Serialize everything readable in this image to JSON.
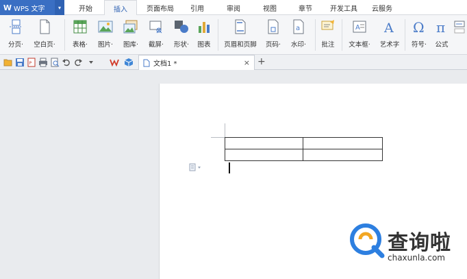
{
  "app": {
    "name": "WPS 文字",
    "logo_letter": "W"
  },
  "menu_tabs": [
    {
      "label": "开始"
    },
    {
      "label": "插入",
      "active": true
    },
    {
      "label": "页面布局"
    },
    {
      "label": "引用"
    },
    {
      "label": "审阅"
    },
    {
      "label": "视图"
    },
    {
      "label": "章节"
    },
    {
      "label": "开发工具"
    },
    {
      "label": "云服务"
    }
  ],
  "ribbon": {
    "page_break": "分页·",
    "blank_page": "空白页·",
    "table": "表格·",
    "picture": "图片·",
    "gallery": "图库·",
    "screenshot": "截屏·",
    "shapes": "形状·",
    "chart": "图表",
    "header_footer": "页眉和页脚",
    "page_number": "页码·",
    "watermark": "水印·",
    "comment": "批注",
    "textbox": "文本框·",
    "wordart": "艺术字",
    "symbol": "符号·",
    "formula": "公式"
  },
  "document_tab": {
    "name": "文档1 *"
  },
  "watermark": {
    "title": "查询啦",
    "url": "chaxunla.com"
  },
  "colors": {
    "accent": "#3a6fc3",
    "ribbon_bg": "#f5f6f8",
    "workspace_bg": "#e9ebee"
  }
}
